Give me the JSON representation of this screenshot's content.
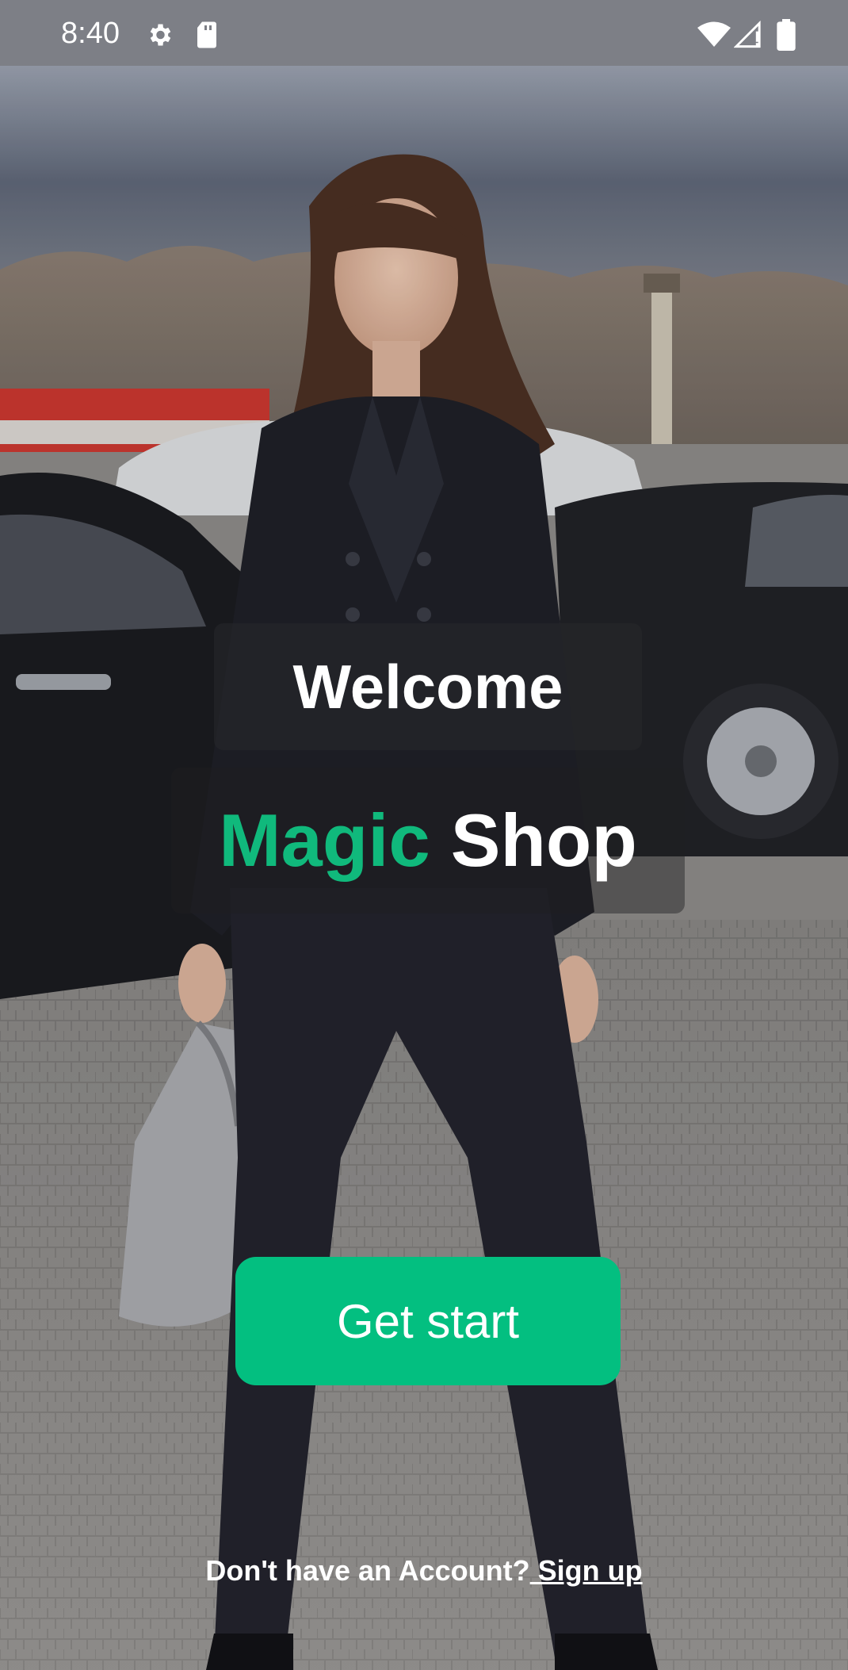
{
  "status_bar": {
    "time": "8:40",
    "icons": [
      "gear-icon",
      "sd-card-icon",
      "wifi-icon",
      "cell-signal-icon",
      "battery-icon"
    ]
  },
  "welcome": {
    "title": "Welcome"
  },
  "brand": {
    "accent_word": "Magic",
    "rest_word": "Shop"
  },
  "actions": {
    "start_label": "Get start"
  },
  "footer": {
    "prompt": "Don't have an Account?",
    "signup_label": " Sign up"
  },
  "colors": {
    "accent": "#03bf80",
    "brand_accent_text": "#10b97c",
    "text": "#ffffff",
    "status_bar": "#7d7f86"
  },
  "background_image": "woman-in-black-suit-street-photo"
}
